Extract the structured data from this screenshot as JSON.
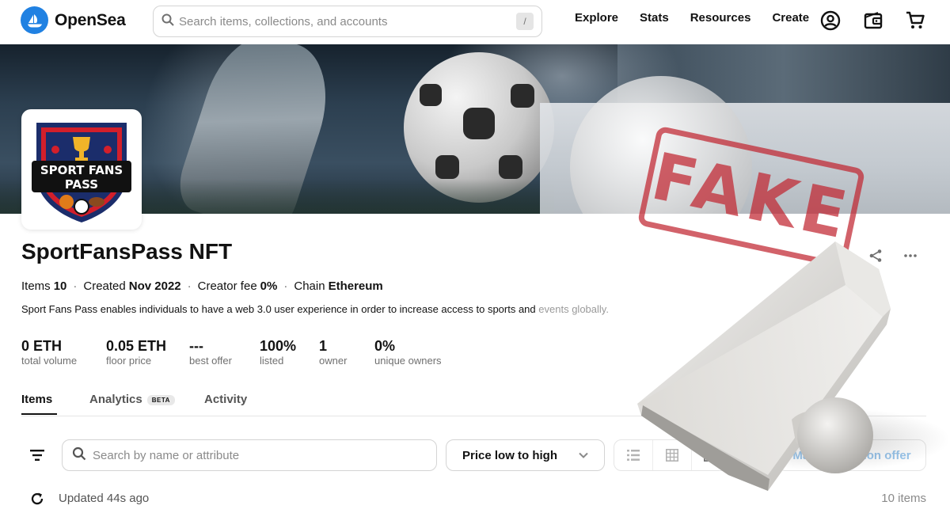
{
  "header": {
    "brand": "OpenSea",
    "search_placeholder": "Search items, collections, and accounts",
    "search_shortcut": "/",
    "nav": [
      "Explore",
      "Stats",
      "Resources",
      "Create"
    ],
    "icons": [
      "account-icon",
      "wallet-icon",
      "cart-icon"
    ]
  },
  "collection": {
    "name": "SportFansPass NFT",
    "avatar_text": [
      "SPORT FANS",
      "PASS"
    ],
    "meta": {
      "items_label": "Items",
      "items_value": "10",
      "created_label": "Created",
      "created_value": "Nov 2022",
      "fee_label": "Creator fee",
      "fee_value": "0%",
      "chain_label": "Chain",
      "chain_value": "Ethereum"
    },
    "description_main": "Sport Fans Pass enables individuals to have a web 3.0 user experience in order to increase access to sports and",
    "description_fade": "events globally.",
    "stats": [
      {
        "value": "0 ETH",
        "label": "total volume"
      },
      {
        "value": "0.05 ETH",
        "label": "floor price"
      },
      {
        "value": "---",
        "label": "best offer"
      },
      {
        "value": "100%",
        "label": "listed"
      },
      {
        "value": "1",
        "label": "owner"
      },
      {
        "value": "0%",
        "label": "unique owners"
      }
    ]
  },
  "tabs": {
    "items": "Items",
    "analytics": "Analytics",
    "analytics_badge": "BETA",
    "activity": "Activity",
    "active": "Items"
  },
  "toolbar": {
    "search_placeholder": "Search by name or attribute",
    "sort_label": "Price low to high",
    "view_modes": [
      "list-view-icon",
      "grid-small-icon",
      "grid-large-icon",
      "grid-mosaic-icon"
    ],
    "offer_button": "Make collection offer"
  },
  "status": {
    "updated": "Updated 44s ago",
    "count": "10 items"
  },
  "overlay": {
    "stamp_text": "FAKE"
  },
  "colors": {
    "brand_blue": "#2081e2",
    "stamp_red": "#c02630",
    "offer_text": "#9ac6ec"
  }
}
